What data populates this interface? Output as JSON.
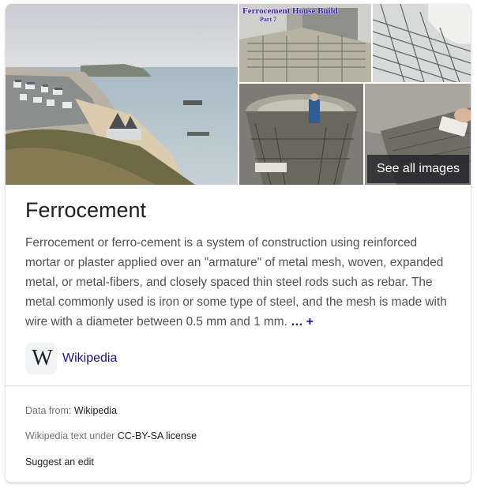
{
  "gallery": {
    "images": [
      {
        "name": "coastal-town-photo"
      },
      {
        "name": "ferrocement-build-photo",
        "overlay_title": "Ferrocement House Build",
        "overlay_part": "Part 7"
      },
      {
        "name": "mesh-plaster-photo"
      },
      {
        "name": "tank-interior-photo"
      },
      {
        "name": "plastering-photo"
      }
    ],
    "see_all_label": "See all images"
  },
  "entity": {
    "title": "Ferrocement",
    "description": "Ferrocement or ferro-cement is a system of construction using reinforced mortar or plaster applied over an \"armature\" of metal mesh, woven, expanded metal, or metal-fibers, and closely spaced thin steel rods such as rebar. The metal commonly used is iron or some type of steel, and the mesh is made with wire with a diameter between 0.5 mm and 1 mm.",
    "more_label": "… +"
  },
  "source": {
    "logo_text": "W",
    "label": "Wikipedia"
  },
  "footer": {
    "data_from_label": "Data from:",
    "data_from_value": "Wikipedia",
    "license_label": "Wikipedia text under",
    "license_value": "CC-BY-SA license",
    "suggest_label": "Suggest an edit"
  },
  "colors": {
    "link": "#1a0dab",
    "text": "#202124",
    "muted": "#70757a"
  }
}
